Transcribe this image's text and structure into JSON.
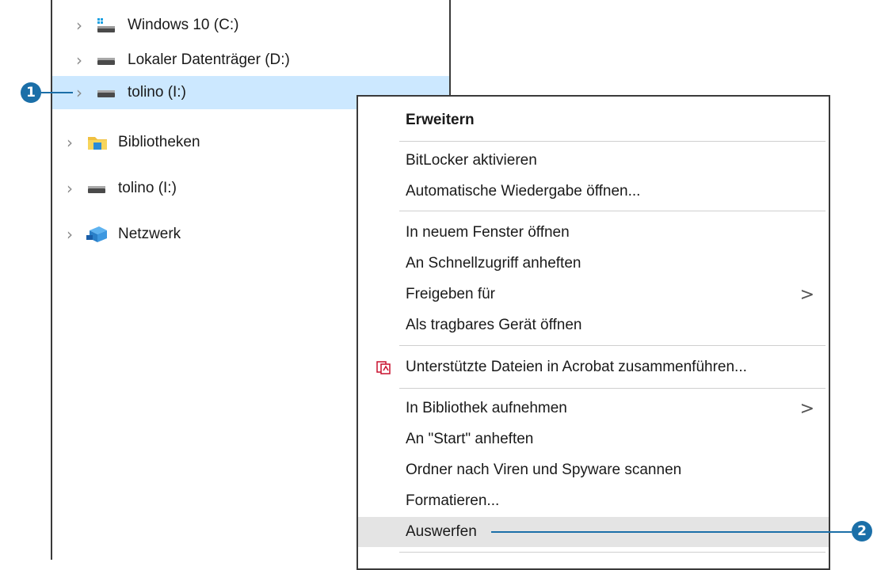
{
  "navigation_pane": {
    "items": [
      {
        "label": "Windows 10 (C:)",
        "icon": "windows-drive-icon"
      },
      {
        "label": "Lokaler Datenträger (D:)",
        "icon": "drive-icon"
      },
      {
        "label": "tolino (I:)",
        "icon": "drive-icon",
        "selected": true
      },
      {
        "label": "Bibliotheken",
        "icon": "libraries-folder-icon"
      },
      {
        "label": "tolino (I:)",
        "icon": "drive-icon"
      },
      {
        "label": "Netzwerk",
        "icon": "network-icon"
      }
    ]
  },
  "context_menu": {
    "items": [
      {
        "label": "Erweitern",
        "bold": true
      },
      {
        "label": "BitLocker aktivieren"
      },
      {
        "label": "Automatische Wiedergabe öffnen..."
      },
      {
        "label": "In neuem Fenster öffnen"
      },
      {
        "label": "An Schnellzugriff anheften"
      },
      {
        "label": "Freigeben für",
        "submenu": true
      },
      {
        "label": "Als tragbares Gerät öffnen"
      },
      {
        "label": "Unterstützte Dateien in Acrobat zusammenführen...",
        "icon": "acrobat-icon"
      },
      {
        "label": "In Bibliothek aufnehmen",
        "submenu": true
      },
      {
        "label": "An \"Start\" anheften"
      },
      {
        "label": "Ordner nach Viren und Spyware scannen"
      },
      {
        "label": "Formatieren..."
      },
      {
        "label": "Auswerfen",
        "highlighted": true
      }
    ],
    "submenu_glyph": ">"
  },
  "callouts": [
    {
      "number": "1"
    },
    {
      "number": "2"
    }
  ],
  "colors": {
    "selection": "#cce8ff",
    "callout": "#1b6fa8",
    "menu_hover": "#e4e4e4"
  }
}
